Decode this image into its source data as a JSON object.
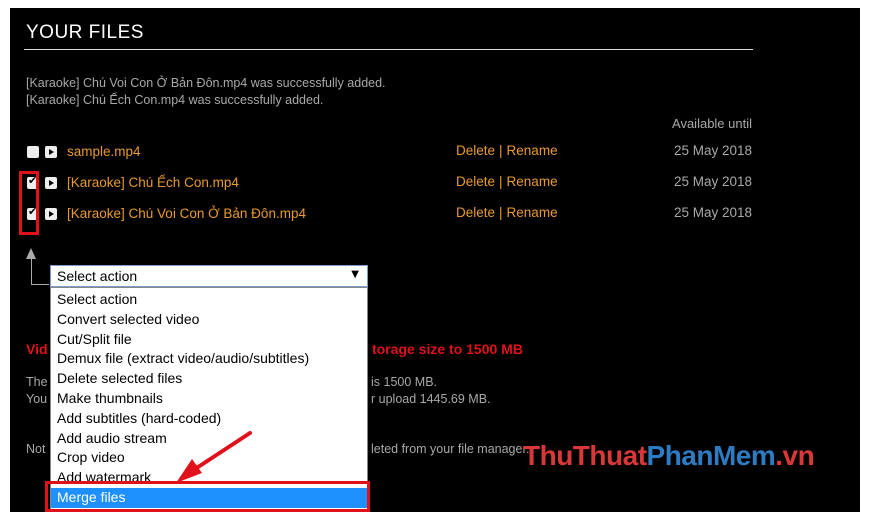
{
  "title": "YOUR FILES",
  "messages": [
    "[Karaoke] Chú Voi Con Ở Bản Đôn.mp4 was successfully added.",
    "[Karaoke] Chú Ếch Con.mp4 was successfully added."
  ],
  "available_header": "Available until",
  "files": [
    {
      "name": "sample.mp4",
      "checked": false,
      "delete": "Delete",
      "sep": "|",
      "rename": "Rename",
      "date": "25 May 2018"
    },
    {
      "name": "[Karaoke] Chú Ếch Con.mp4",
      "checked": true,
      "delete": "Delete",
      "sep": "|",
      "rename": "Rename",
      "date": "25 May 2018"
    },
    {
      "name": "[Karaoke] Chú Voi Con Ở Bản Đôn.mp4",
      "checked": true,
      "delete": "Delete",
      "sep": "|",
      "rename": "Rename",
      "date": "25 May 2018"
    }
  ],
  "select": {
    "value": "Select action",
    "options": [
      "Select action",
      "Convert selected video",
      "Cut/Split file",
      "Demux file (extract video/audio/subtitles)",
      "Delete selected files",
      "Make thumbnails",
      "Add subtitles (hard-coded)",
      "Add audio stream",
      "Crop video",
      "Add watermark",
      "Merge files"
    ],
    "highlighted": "Merge files"
  },
  "background_text": {
    "red_left": "Vid",
    "red_right": "torage size to 1500 MB",
    "gray_1_left": "The",
    "gray_1_right": "is 1500 MB.",
    "gray_2_left": "You",
    "gray_2_right": "r upload 1445.69 MB.",
    "gray_3_left": "Not",
    "gray_3_right": "leted from your file manager."
  },
  "watermark": {
    "part1": "ThuThuat",
    "part2": "PhanMem",
    "part3": ".vn"
  },
  "colors": {
    "accent": "#e89a2e",
    "highlight": "#e0111b",
    "selected": "#1e90ff"
  }
}
